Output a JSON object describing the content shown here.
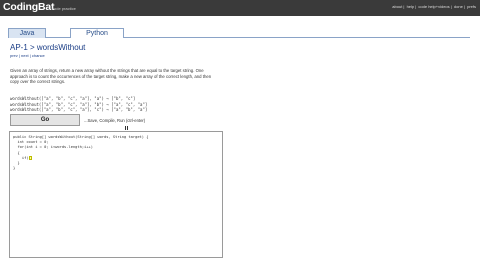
{
  "header": {
    "logo": "CodingBat",
    "tagline": "code practice",
    "links": [
      "about",
      "help",
      "code help+videos",
      "done",
      "prefs"
    ]
  },
  "tabs": {
    "java": "Java",
    "python": "Python"
  },
  "breadcrumb": "AP-1 > wordsWithout",
  "subnav": "prev  |  next  |  chance",
  "description": "Given an array of strings, return a new array without the strings that are equal to the target string. One approach is to count the occurrences of the target string, make a new array of the correct length, and then copy over the correct strings.",
  "examples": [
    "wordsWithout([\"a\", \"b\", \"c\", \"a\"], \"a\") → [\"b\", \"c\"]",
    "wordsWithout([\"a\", \"b\", \"c\", \"a\"], \"b\") → [\"a\", \"c\", \"a\"]",
    "wordsWithout([\"a\", \"b\", \"c\", \"a\"], \"c\") → [\"a\", \"b\", \"a\"]"
  ],
  "go_button": "Go",
  "go_hint": "...Save, Compile, Run (ctrl-enter)",
  "code_lines": [
    "public String[] wordsWithout(String[] words, String target) {",
    "  int count = 0;",
    "  for(int i = 0; i<words.length;i++)",
    "  {",
    "    if("
  ],
  "code_closing": [
    "  }",
    "}"
  ]
}
